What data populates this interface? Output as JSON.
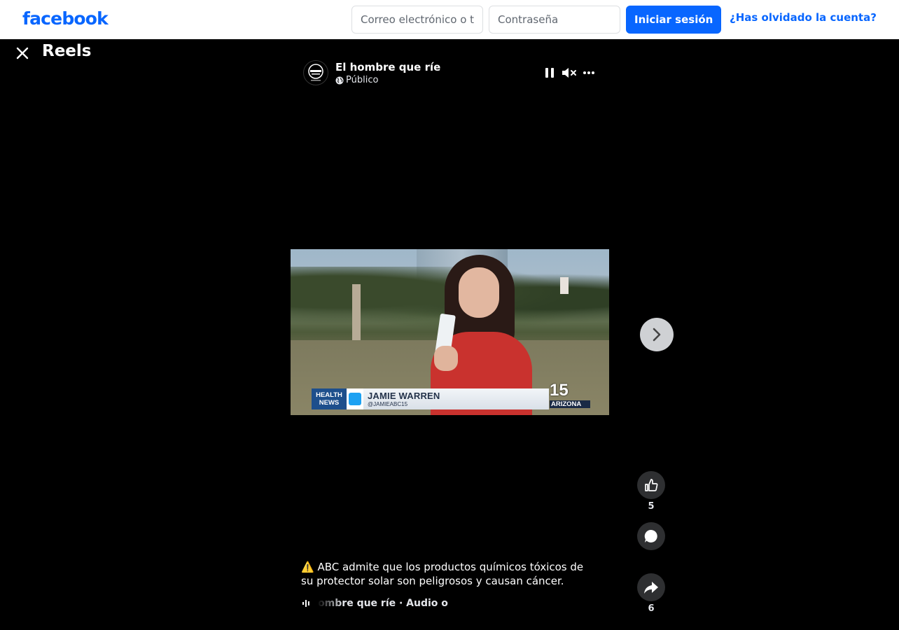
{
  "header": {
    "logo": "facebook",
    "email_placeholder": "Correo electrónico o teléfono",
    "password_placeholder": "Contraseña",
    "login_label": "Iniciar sesión",
    "forgot_label": "¿Has olvidado la cuenta?"
  },
  "reels": {
    "title": "Reels"
  },
  "reel": {
    "author": "El hombre que ríe",
    "privacy": "Público",
    "video": {
      "lower_third_tag": "HEALTH NEWS",
      "reporter_name": "JAMIE WARREN",
      "reporter_handle": "@JAMIEABC15",
      "station_number": "15",
      "station_name": "ARIZONA"
    },
    "likes": "5",
    "shares": "6",
    "caption": "⚠️ ABC admite que los productos químicos tóxicos de su protector solar son peligrosos y causan cáncer.",
    "audio": "El hombre que ríe · Audio original"
  },
  "icons": {
    "close": "close-icon",
    "pause": "pause-icon",
    "mute": "muted-speaker-icon",
    "more": "more-options-icon",
    "globe": "globe-icon",
    "next": "chevron-right-icon",
    "like": "thumbs-up-icon",
    "comment": "comment-bubble-icon",
    "share": "share-arrow-icon",
    "audio": "audio-wave-icon"
  },
  "colors": {
    "brand": "#0866ff",
    "background": "#000000",
    "action_button": "#2e2f31"
  }
}
